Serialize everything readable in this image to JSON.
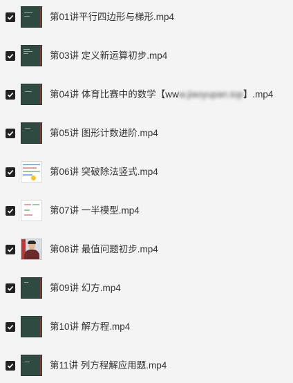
{
  "files": [
    {
      "name": "第01讲平行四边形与梯形.mp4",
      "checked": true,
      "thumbnail": "chalkboard"
    },
    {
      "name": "第03讲 定义新运算初步.mp4",
      "checked": true,
      "thumbnail": "chalkboard"
    },
    {
      "name_prefix": "第04讲 体育比赛中的数学【ww",
      "name_obscured": "w.jiaoyupan.top",
      "name_suffix": "】.mp4",
      "checked": true,
      "thumbnail": "chalkboard"
    },
    {
      "name": "第05讲 图形计数进阶.mp4",
      "checked": true,
      "thumbnail": "chalkboard"
    },
    {
      "name": "第06讲 突破除法竖式.mp4",
      "checked": true,
      "thumbnail": "worksheet"
    },
    {
      "name": "第07讲 一半模型.mp4",
      "checked": true,
      "thumbnail": "worksheet"
    },
    {
      "name": "第08讲 最值问题初步.mp4",
      "checked": true,
      "thumbnail": "teacher-photo"
    },
    {
      "name": "第09讲 幻方.mp4",
      "checked": true,
      "thumbnail": "chalkboard"
    },
    {
      "name": "第10讲 解方程.mp4",
      "checked": true,
      "thumbnail": "chalkboard"
    },
    {
      "name": "第11讲 列方程解应用题.mp4",
      "checked": true,
      "thumbnail": "chalkboard"
    }
  ],
  "colors": {
    "background": "#f4f4f5",
    "checkbox": "#222222",
    "chalkboard": "#2f4a40",
    "text": "#333333"
  }
}
